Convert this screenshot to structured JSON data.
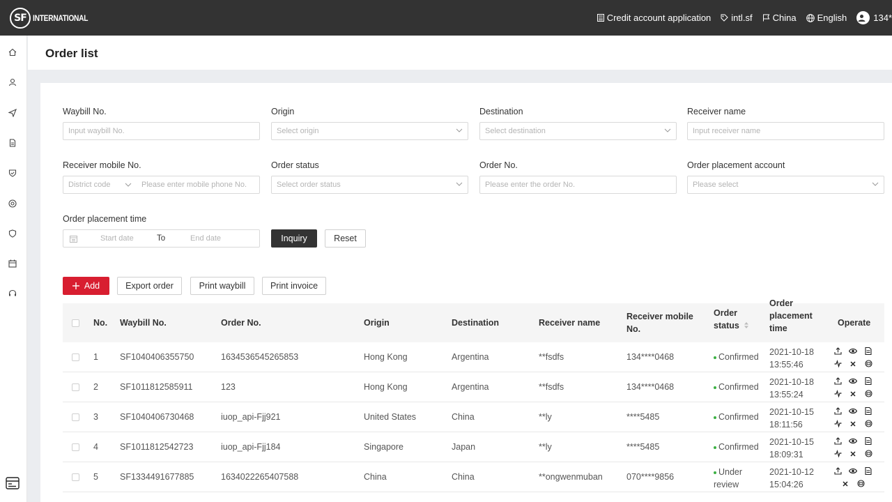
{
  "topbar": {
    "logo_mark": "SF",
    "logo_text": "INTERNATIONAL",
    "credit": "Credit account application",
    "intl": "intl.sf",
    "country": "China",
    "language": "English",
    "user": "134*"
  },
  "page": {
    "title": "Order list"
  },
  "filters": {
    "waybill_label": "Waybill No.",
    "waybill_placeholder": "Input waybill No.",
    "origin_label": "Origin",
    "origin_placeholder": "Select origin",
    "destination_label": "Destination",
    "destination_placeholder": "Select destination",
    "receiver_label": "Receiver name",
    "receiver_placeholder": "Input receiver name",
    "mobile_label": "Receiver mobile No.",
    "district_placeholder": "District code",
    "mobile_placeholder": "Please enter mobile phone No.",
    "status_label": "Order status",
    "status_placeholder": "Select order status",
    "orderno_label": "Order No.",
    "orderno_placeholder": "Please enter the order No.",
    "account_label": "Order placement account",
    "account_placeholder": "Please select",
    "time_label": "Order placement time",
    "start_placeholder": "Start date",
    "to": "To",
    "end_placeholder": "End date",
    "inquiry": "Inquiry",
    "reset": "Reset"
  },
  "actions": {
    "add": "Add",
    "export": "Export order",
    "print_waybill": "Print waybill",
    "print_invoice": "Print invoice"
  },
  "table": {
    "headers": {
      "no": "No.",
      "waybill": "Waybill No.",
      "order": "Order No.",
      "origin": "Origin",
      "destination": "Destination",
      "receiver": "Receiver name",
      "mobile_1": "Receiver mobile",
      "mobile_2": "No.",
      "status_1": "Order",
      "status_2": "status",
      "time_1": "Order",
      "time_2": "placement",
      "time_3": "time",
      "operate": "Operate"
    },
    "rows": [
      {
        "no": "1",
        "waybill": "SF1040406355750",
        "order": "1634536545265853",
        "origin": "Hong Kong",
        "destination": "Argentina",
        "receiver": "**fsdfs",
        "mobile": "134****0468",
        "status": "Confirmed",
        "date": "2021-10-18",
        "time": "13:55:46"
      },
      {
        "no": "2",
        "waybill": "SF1011812585911",
        "order": "123",
        "origin": "Hong Kong",
        "destination": "Argentina",
        "receiver": "**fsdfs",
        "mobile": "134****0468",
        "status": "Confirmed",
        "date": "2021-10-18",
        "time": "13:55:24"
      },
      {
        "no": "3",
        "waybill": "SF1040406730468",
        "order": "iuop_api-Fjj921",
        "origin": "United States",
        "destination": "China",
        "receiver": "**ly",
        "mobile": "****5485",
        "status": "Confirmed",
        "date": "2021-10-15",
        "time": "18:11:56"
      },
      {
        "no": "4",
        "waybill": "SF1011812542723",
        "order": "iuop_api-Fjj184",
        "origin": "Singapore",
        "destination": "Japan",
        "receiver": "**ly",
        "mobile": "****5485",
        "status": "Confirmed",
        "date": "2021-10-15",
        "time": "18:09:31"
      },
      {
        "no": "5",
        "waybill": "SF1334491677885",
        "order": "1634022265407588",
        "origin": "China",
        "destination": "China",
        "receiver": "**ongwenmuban",
        "mobile": "070****9856",
        "status_1": "Under",
        "status_2": "review",
        "date": "2021-10-12",
        "time": "15:04:26"
      }
    ]
  },
  "colors": {
    "topbar": "#333333",
    "primary_red": "#d81e30",
    "status_green": "#3cb043"
  }
}
